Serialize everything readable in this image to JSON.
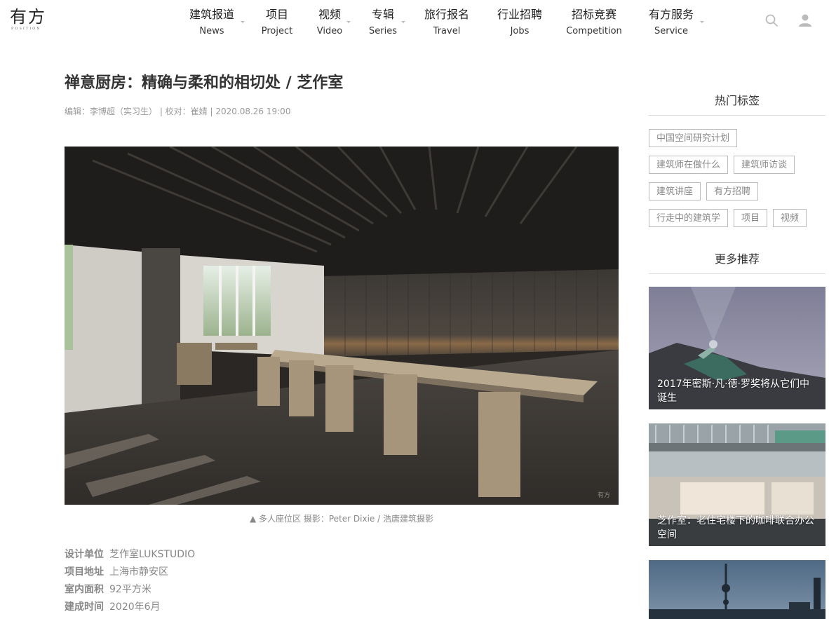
{
  "logo": {
    "cn": "有方",
    "en": "POSITION"
  },
  "nav": [
    {
      "cn": "建筑报道",
      "en": "News"
    },
    {
      "cn": "项目",
      "en": "Project"
    },
    {
      "cn": "视频",
      "en": "Video"
    },
    {
      "cn": "专辑",
      "en": "Series"
    },
    {
      "cn": "旅行报名",
      "en": "Travel"
    },
    {
      "cn": "行业招聘",
      "en": "Jobs"
    },
    {
      "cn": "招标竞赛",
      "en": "Competition"
    },
    {
      "cn": "有方服务",
      "en": "Service"
    }
  ],
  "article": {
    "title": "禅意厨房：精确与柔和的相切处 / 芝作室",
    "meta": "编辑：李博超（实习生） | 校对：崔婧 | 2020.08.26 19:00",
    "caption": "▲ 多人座位区 摄影：Peter Dixie / 浩唐建筑摄影",
    "watermark": "有方",
    "info": [
      {
        "label": "设计单位",
        "value": "芝作室LUKSTUDIO"
      },
      {
        "label": "项目地址",
        "value": "上海市静安区"
      },
      {
        "label": "室内面积",
        "value": "92平方米"
      },
      {
        "label": "建成时间",
        "value": "2020年6月"
      }
    ]
  },
  "sidebar": {
    "tags_heading": "热门标签",
    "tags": [
      "中国空间研究计划",
      "建筑师在做什么",
      "建筑师访谈",
      "建筑讲座",
      "有方招聘",
      "行走中的建筑学",
      "项目",
      "视频"
    ],
    "more_heading": "更多推荐",
    "recommendations": [
      {
        "title": "2017年密斯·凡·德·罗奖将从它们中诞生"
      },
      {
        "title": "芝作室：老住宅楼下的咖啡联合办公空间"
      },
      {
        "title": ""
      }
    ]
  },
  "icons": {
    "search": "search-icon",
    "user": "user-icon"
  }
}
